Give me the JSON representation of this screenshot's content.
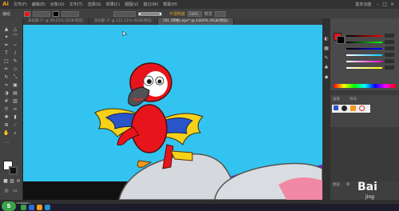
{
  "app": {
    "logo": "Ai",
    "menu": [
      "文件(F)",
      "编辑(E)",
      "对象(O)",
      "文字(T)",
      "选择(S)",
      "效果(C)",
      "视图(V)",
      "窗口(W)",
      "帮助(H)"
    ],
    "workspace": "基本功能"
  },
  "control_bar": {
    "label": "编组",
    "opacity_label": "不透明度",
    "opacity_value": "100%",
    "style_label": "样式"
  },
  "tabs": [
    {
      "label": "未标题-1* @ 49.01% (RGB/预览)",
      "active": false
    },
    {
      "label": "未标题-3* @ 111.11% (RGB/预览)",
      "active": false
    },
    {
      "label": "781 (转换).eps* @ 1400% (RGB/预览)",
      "active": true
    }
  ],
  "right_panels": {
    "tab_brush": "画笔",
    "tab_symbol": "符号",
    "tab_layers": "图层",
    "tab_libraries": "库"
  },
  "status": {
    "zoom": "1400%"
  },
  "watermark": {
    "text": "Bai",
    "sub": "jing"
  },
  "colors": {
    "canvas_bg": "#33c3f0",
    "parrot_red": "#e8141b",
    "wing_yellow": "#f6d11a",
    "wing_blue": "#2a55c8",
    "rock": "#d5d8dc"
  }
}
